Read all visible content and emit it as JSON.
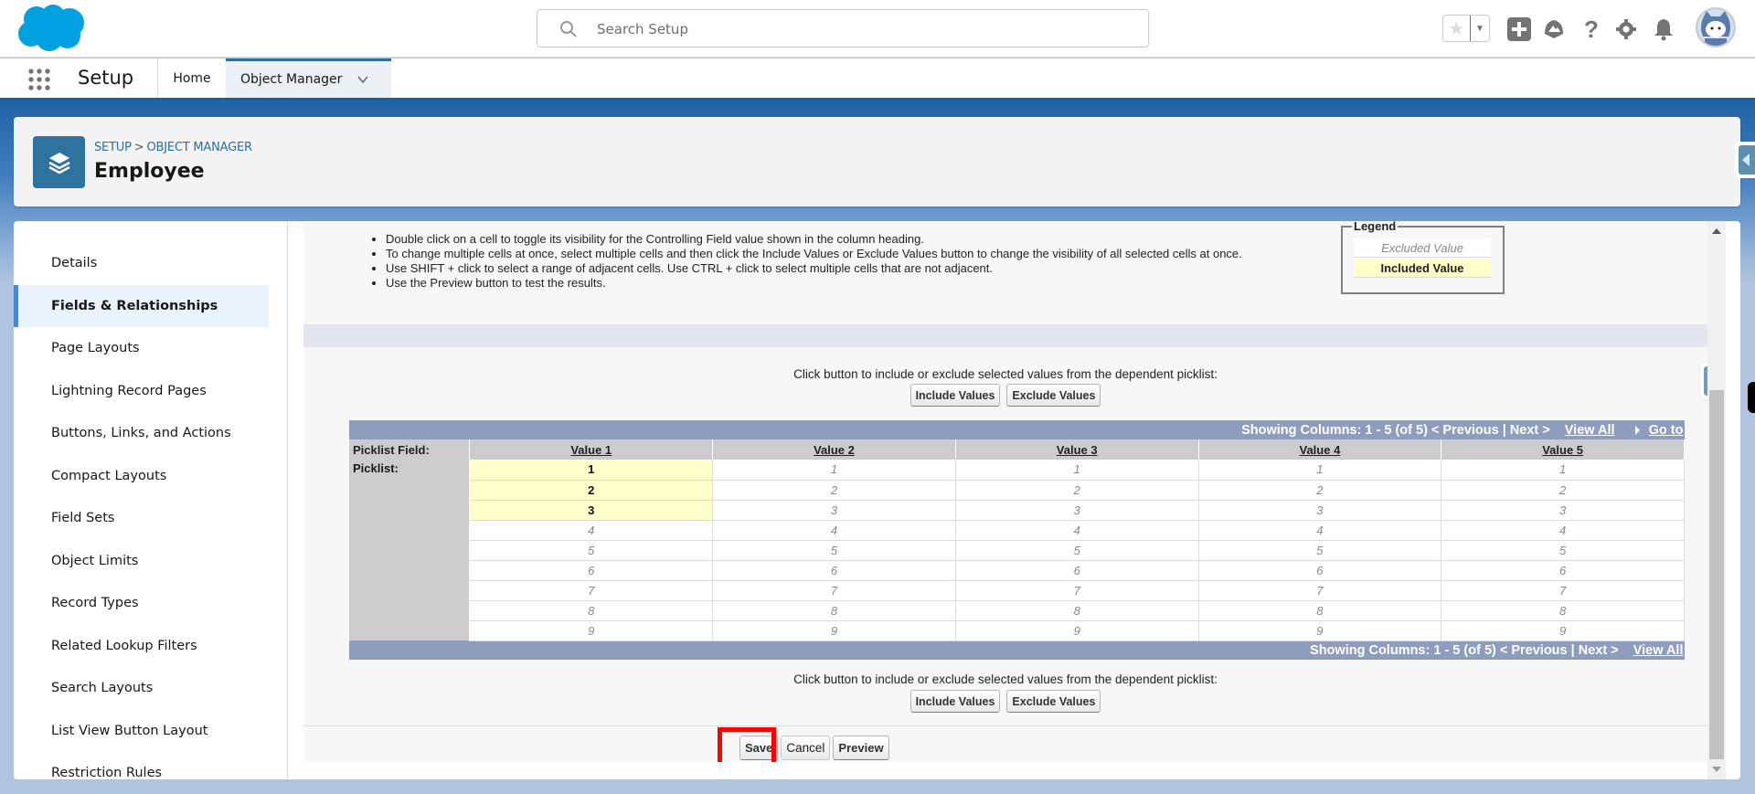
{
  "topbar": {
    "search_placeholder": "Search Setup",
    "icons": [
      "salesforce-cloud-logo",
      "search-icon",
      "favorites-star-icon",
      "favorites-dropdown-icon",
      "global-actions-plus-icon",
      "trailhead-icon",
      "help-icon",
      "setup-gear-icon",
      "notifications-bell-icon",
      "user-avatar"
    ]
  },
  "nav": {
    "app_name": "Setup",
    "tabs": [
      {
        "label": "Home",
        "active": false
      },
      {
        "label": "Object Manager",
        "active": true
      }
    ]
  },
  "header": {
    "breadcrumb": [
      "SETUP",
      "OBJECT MANAGER"
    ],
    "breadcrumb_sep": ">",
    "title": "Employee"
  },
  "sidebar": {
    "items": [
      {
        "label": "Details",
        "active": false
      },
      {
        "label": "Fields & Relationships",
        "active": true
      },
      {
        "label": "Page Layouts",
        "active": false
      },
      {
        "label": "Lightning Record Pages",
        "active": false
      },
      {
        "label": "Buttons, Links, and Actions",
        "active": false
      },
      {
        "label": "Compact Layouts",
        "active": false
      },
      {
        "label": "Field Sets",
        "active": false
      },
      {
        "label": "Object Limits",
        "active": false
      },
      {
        "label": "Record Types",
        "active": false
      },
      {
        "label": "Related Lookup Filters",
        "active": false
      },
      {
        "label": "Search Layouts",
        "active": false
      },
      {
        "label": "List View Button Layout",
        "active": false
      },
      {
        "label": "Restriction Rules",
        "active": false
      }
    ]
  },
  "instructions": [
    "Double click on a cell to toggle its visibility for the Controlling Field value shown in the column heading.",
    "To change multiple cells at once, select multiple cells and then click the Include Values or Exclude Values button to change the visibility of all selected cells at once.",
    "Use SHIFT + click to select a range of adjacent cells. Use CTRL + click to select multiple cells that are not adjacent.",
    "Use the Preview button to test the results."
  ],
  "legend": {
    "title": "Legend",
    "excluded": "Excluded Value",
    "included": "Included Value"
  },
  "actions": {
    "click_text": "Click button to include or exclude selected values from the dependent picklist:",
    "include": "Include Values",
    "exclude": "Exclude Values"
  },
  "grid": {
    "pager_top": {
      "showing": "Showing Columns: 1 - 5 (of 5) < Previous | Next >",
      "view_all": "View All",
      "goto": "Go to"
    },
    "pager_bottom": {
      "showing": "Showing Columns: 1 - 5 (of 5) < Previous | Next >",
      "view_all": "View All"
    },
    "controlling_label": "Picklist Field:",
    "dependent_label": "Picklist:",
    "columns": [
      "Value 1",
      "Value 2",
      "Value 3",
      "Value 4",
      "Value 5"
    ],
    "rows": [
      "1",
      "2",
      "3",
      "4",
      "5",
      "6",
      "7",
      "8",
      "9"
    ],
    "included": {
      "Value 1": [
        "1",
        "2",
        "3"
      ],
      "Value 2": [],
      "Value 3": [],
      "Value 4": [],
      "Value 5": []
    }
  },
  "footer": {
    "save": "Save",
    "cancel": "Cancel",
    "preview": "Preview",
    "highlighted": "Save"
  },
  "colors": {
    "included_bg": "#ffffcc",
    "pager_bg": "#8e9dbe",
    "header_cell_bg": "#cccccc",
    "highlight_box": "#ff0000",
    "brand_blue": "#00a1e0"
  }
}
